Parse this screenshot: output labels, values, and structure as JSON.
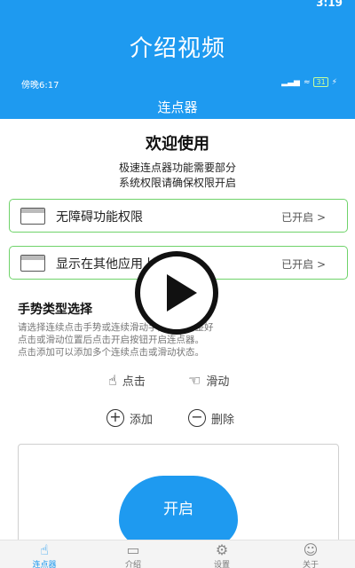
{
  "video_header": {
    "title": "介绍视频"
  },
  "outer_status": {
    "time": "3:19"
  },
  "inner_status": {
    "time": "傍晚6:17",
    "battery": "31"
  },
  "app_bar": {
    "title": "连点器"
  },
  "welcome": {
    "title": "欢迎使用",
    "line1": "极速连点器功能需要部分",
    "line2": "系统权限请确保权限开启"
  },
  "permissions": [
    {
      "label": "无障碍功能权限",
      "status": "已开启 >"
    },
    {
      "label": "显示在其他应用上层",
      "status": "已开启 >"
    }
  ],
  "gesture": {
    "title": "手势类型选择",
    "desc": [
      "请选择连续点击手势或连续滑动手势，请调整好",
      "点击或滑动位置后点击开启按钮开启连点器。",
      "点击添加可以添加多个连续点击或滑动状态。"
    ],
    "click_label": "点击",
    "slide_label": "滑动",
    "add_label": "添加",
    "delete_label": "删除"
  },
  "start_button": "开启",
  "bottom_nav": [
    {
      "label": "连点器",
      "icon": "tap-hand-icon",
      "active": true
    },
    {
      "label": "介绍",
      "icon": "doc-icon",
      "active": false
    },
    {
      "label": "设置",
      "icon": "gear-icon",
      "active": false
    },
    {
      "label": "关于",
      "icon": "person-icon",
      "active": false
    }
  ],
  "colors": {
    "primary": "#1e9af0",
    "card_border": "#6fd36a"
  }
}
